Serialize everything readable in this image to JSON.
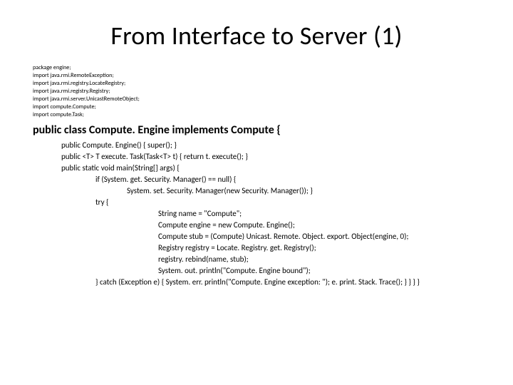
{
  "title": "From Interface to Server (1)",
  "imports": [
    "package engine;",
    "import java.rmi.RemoteException;",
    "import java.rmi.registry.LocateRegistry;",
    "import java.rmi.registry.Registry;",
    "import java.rmi.server.UnicastRemoteObject;",
    "import compute.Compute;",
    "import compute.Task;"
  ],
  "classdecl": "public class Compute. Engine implements Compute {",
  "body": [
    {
      "indent": 1,
      "text": "public Compute. Engine() {   super();  }"
    },
    {
      "indent": 1,
      "text": "public <T> T execute. Task(Task<T> t) { return t. execute(); }"
    },
    {
      "indent": 1,
      "text": "public static void main(String[] args) {"
    },
    {
      "indent": 2,
      "text": "if (System. get. Security. Manager() == null) {"
    },
    {
      "indent": 3,
      "text": "System. set. Security. Manager(new Security. Manager()); }"
    },
    {
      "indent": 2,
      "text": "try {"
    },
    {
      "indent": 4,
      "text": "String name = \"Compute\";"
    },
    {
      "indent": 4,
      "text": "Compute engine = new Compute. Engine();"
    },
    {
      "indent": 4,
      "text": "Compute stub = (Compute) Unicast. Remote. Object. export. Object(engine, 0);"
    },
    {
      "indent": 4,
      "text": "Registry registry = Locate. Registry. get. Registry();"
    },
    {
      "indent": 4,
      "text": "registry. rebind(name, stub);"
    },
    {
      "indent": 4,
      "text": "System. out. println(\"Compute. Engine bound\");"
    },
    {
      "indent": 2,
      "text": "} catch (Exception e) { System. err. println(\"Compute. Engine exception: \"); e. print. Stack. Trace(); } } } }"
    }
  ]
}
